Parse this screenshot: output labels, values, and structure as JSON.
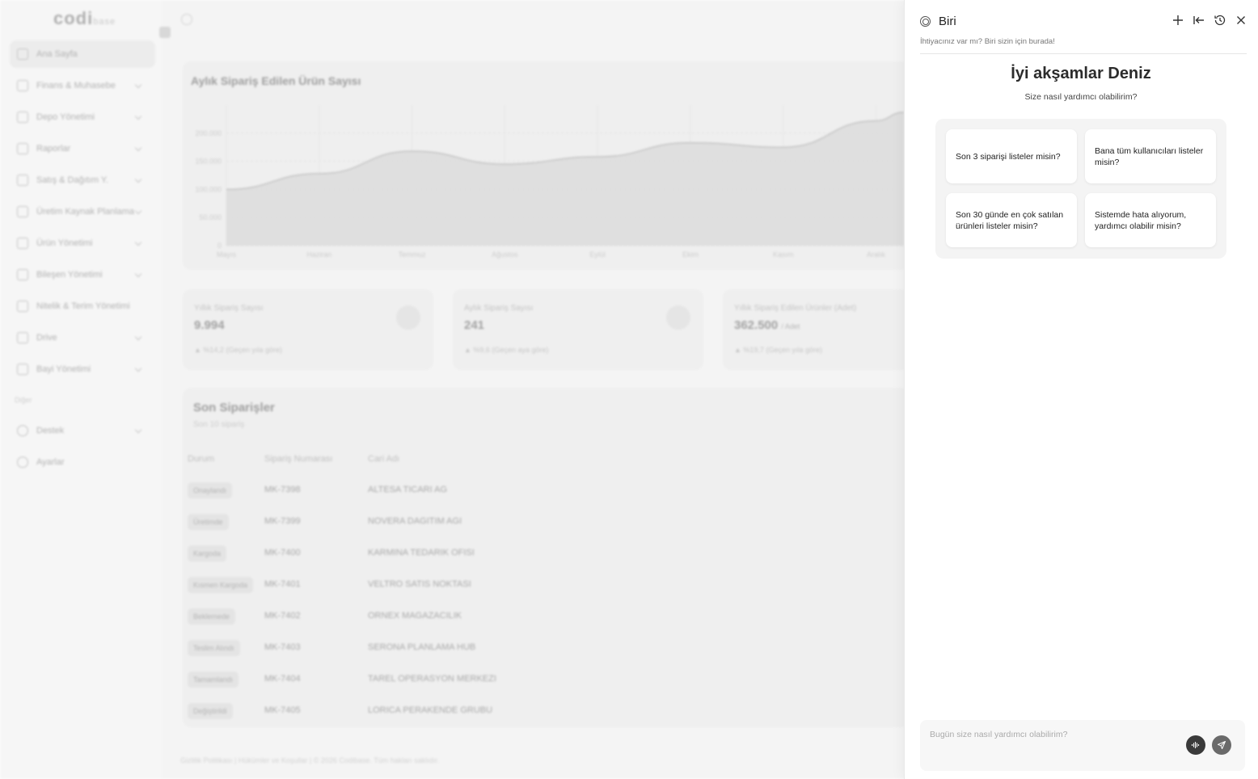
{
  "app": {
    "logo": "codi",
    "logo_suffix": "base",
    "sidebar": {
      "items": [
        {
          "label": "Ana Sayfa",
          "active": true
        },
        {
          "label": "Finans & Muhasebe"
        },
        {
          "label": "Depo Yönetimi"
        },
        {
          "label": "Raporlar"
        },
        {
          "label": "Satış & Dağıtım Y."
        },
        {
          "label": "Üretim Kaynak Planlama"
        },
        {
          "label": "Ürün Yönetimi"
        },
        {
          "label": "Bileşen Yönetimi"
        },
        {
          "label": "Nitelik & Terim Yönetimi"
        },
        {
          "label": "Drive"
        },
        {
          "label": "Bayi Yönetimi"
        }
      ],
      "section_label": "Diğer",
      "other_items": [
        {
          "label": "Destek"
        },
        {
          "label": "Ayarlar"
        }
      ]
    },
    "chart_card": {
      "title": "Aylık Sipariş Edilen Ürün Sayısı"
    },
    "chart_data": {
      "type": "area",
      "title": "Aylık Sipariş Edilen Ürün Sayısı",
      "categories": [
        "Mayıs",
        "Haziran",
        "Temmuz",
        "Ağustos",
        "Eylül",
        "Ekim",
        "Kasım",
        "Aralık"
      ],
      "values": [
        100000,
        128000,
        168000,
        145000,
        158000,
        183000,
        175000,
        222000
      ],
      "y_ticks": [
        "0",
        "50.000",
        "100.000",
        "150.000",
        "200.000"
      ],
      "ylim": [
        0,
        250000
      ],
      "grid": true
    },
    "stats": [
      {
        "label": "Yıllık Sipariş Sayısı",
        "value": "9.994",
        "unit": "",
        "trend": "%14,2 (Geçen yıla göre)"
      },
      {
        "label": "Aylık Sipariş Sayısı",
        "value": "241",
        "unit": "",
        "trend": "%9,6 (Geçen aya göre)"
      },
      {
        "label": "Yıllık Sipariş Edilen Ürünler (Adet)",
        "value": "362.500",
        "unit": "/ Adet",
        "trend": "%19,7 (Geçen yıla göre)"
      }
    ],
    "orders": {
      "title": "Son Siparişler",
      "subtitle": "Son 10 sipariş",
      "columns": [
        "Durum",
        "Sipariş Numarası",
        "Cari Adı"
      ],
      "rows": [
        {
          "status": "Onaylandı",
          "number": "MK-7398",
          "name": "ALTESA TICARI AG"
        },
        {
          "status": "Üretimde",
          "number": "MK-7399",
          "name": "NOVERA DAGITIM AGI"
        },
        {
          "status": "Kargoda",
          "number": "MK-7400",
          "name": "KARMINA TEDARIK OFISI"
        },
        {
          "status": "Kısmen Kargoda",
          "number": "MK-7401",
          "name": "VELTRO SATIS NOKTASI"
        },
        {
          "status": "Beklemede",
          "number": "MK-7402",
          "name": "ORNEX MAGAZACILIK"
        },
        {
          "status": "Teslim Alındı",
          "number": "MK-7403",
          "name": "SERONA PLANLAMA HUB"
        },
        {
          "status": "Tamamlandı",
          "number": "MK-7404",
          "name": "TAREL OPERASYON MERKEZI"
        },
        {
          "status": "Değiştirildi",
          "number": "MK-7405",
          "name": "LORICA PERAKENDE GRUBU"
        }
      ]
    },
    "footer": "Gizlilik Politikası  |  Hükümler ve Koşullar  |  © 2026 Codibase. Tüm hakları saklıdır."
  },
  "panel": {
    "title": "Biri",
    "subtitle": "İhtiyacınız var mı? Biri sizin için burada!",
    "actions": [
      "plus-icon",
      "collapse-left-icon",
      "history-icon",
      "close-icon"
    ],
    "greeting": "İyi akşamlar Deniz",
    "greeting_sub": "Size nasıl yardımcı olabilirim?",
    "suggestions": [
      "Son 3 siparişi listeler misin?",
      "Bana tüm kullanıcıları listeler misin?",
      "Son 30 günde en çok satılan ürünleri listeler misin?",
      "Sistemde hata alıyorum, yardımcı olabilir misin?"
    ],
    "composer": {
      "placeholder": "Bugün size nasıl yardımcı olabilirim?",
      "value": ""
    }
  }
}
